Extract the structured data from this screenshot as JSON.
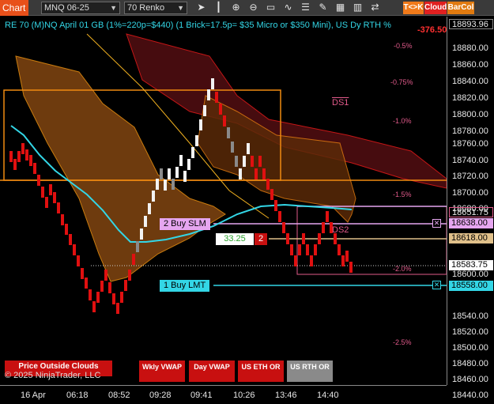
{
  "toolbar": {
    "title": "Chart",
    "instrument": "MNQ 06-25",
    "bar_type": "70 Renko",
    "buttons": [
      {
        "label": "T<>K",
        "color": "#f07a1a",
        "text_color": "#ffffff"
      },
      {
        "label": "Cloud",
        "color": "#e02020",
        "text_color": "#ffffff"
      },
      {
        "label": "BarCol",
        "color": "#e07a10",
        "text_color": "#ffffff"
      }
    ],
    "icons": [
      "cursor-icon",
      "bar-style-icon",
      "zoom-in-icon",
      "zoom-out-icon",
      "data-box-icon",
      "indicators-icon",
      "strategies-icon",
      "drawing-tools-icon",
      "properties-icon",
      "chart-trader-icon"
    ]
  },
  "header": {
    "text": "RE 70 (M)NQ April 01 GB (1%=220p=$440) (1 Brick=17.5p= $35 Micro or $350 Mini), US Dy RTH %",
    "pnl": "-376.50"
  },
  "percent_labels": [
    "-0.5%",
    "-0.75%",
    "-1.0%",
    "-1.5%",
    "-2.0%",
    "-2.5%"
  ],
  "ds_labels": [
    "DS1",
    "DS2"
  ],
  "y_axis": {
    "ticks": [
      "18880.00",
      "18860.00",
      "18840.00",
      "18820.00",
      "18800.00",
      "18780.00",
      "18760.00",
      "18740.00",
      "18720.00",
      "18700.00",
      "18680.00",
      "18600.00",
      "18540.00",
      "18520.00",
      "18500.00",
      "18480.00",
      "18460.00",
      "18440.00"
    ],
    "tags": [
      {
        "value": "18893.96",
        "bg": "#000000",
        "fg": "#e6e6e6",
        "border": "#888888"
      },
      {
        "value": "18651.75",
        "bg": "#000000",
        "fg": "#e6e6e6",
        "border": "#e05a8a"
      },
      {
        "value": "18638.00",
        "bg": "#e6a6f0",
        "fg": "#000000",
        "border": "#e6a6f0"
      },
      {
        "value": "18618.00",
        "bg": "#e0c08a",
        "fg": "#000000",
        "border": "#e0c08a"
      },
      {
        "value": "18583.75",
        "bg": "#ffffff",
        "fg": "#000000",
        "border": "#ffffff"
      },
      {
        "value": "18558.00",
        "bg": "#33d6e6",
        "fg": "#000000",
        "border": "#33d6e6"
      }
    ]
  },
  "x_axis": [
    "16 Apr",
    "06:18",
    "08:52",
    "09:28",
    "09:41",
    "10:26",
    "13:46",
    "14:40"
  ],
  "orders": [
    {
      "label": "2 Buy SLM",
      "price": "18638.00"
    },
    {
      "label": "1 Buy LMT",
      "price": "18558.00"
    }
  ],
  "position": {
    "pnl_points": "33.25",
    "qty": "2"
  },
  "bottom_buttons": [
    {
      "label": "Price Outside Clouds",
      "color": "#c81010"
    },
    {
      "label": "Wkly VWAP",
      "color": "#c81010"
    },
    {
      "label": "Day VWAP",
      "color": "#c81010"
    },
    {
      "label": "US ETH OR",
      "color": "#c81010"
    },
    {
      "label": "US RTH OR",
      "color": "#8a8a8a"
    }
  ],
  "copyright": "© 2025 NinjaTrader, LLC"
}
